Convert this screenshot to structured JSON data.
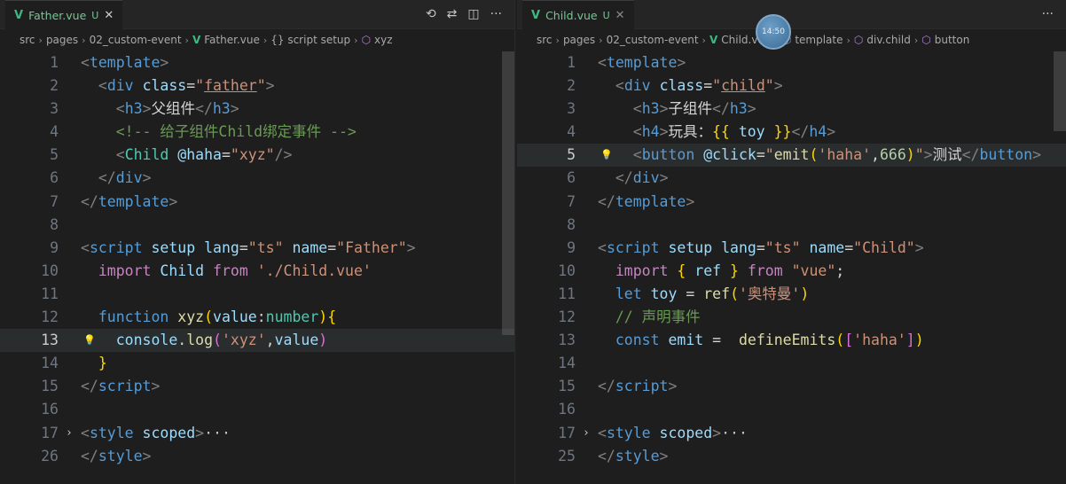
{
  "left": {
    "tab": {
      "name": "Father.vue",
      "status": "U",
      "close": "✕"
    },
    "toolbar": {
      "icons": [
        "history-icon",
        "compare-icon",
        "split-editor-icon",
        "more-icon"
      ],
      "glyphs": [
        "⟲",
        "⇄",
        "◫",
        "···"
      ]
    },
    "breadcrumb": [
      "src",
      "pages",
      "02_custom-event",
      "Father.vue",
      "{} script setup",
      "xyz"
    ],
    "lines": [
      {
        "n": "1",
        "tokens": [
          [
            "t-punc",
            "<"
          ],
          [
            "t-tag",
            "template"
          ],
          [
            "t-punc",
            ">"
          ]
        ]
      },
      {
        "n": "2",
        "tokens": [
          [
            "t-text",
            "  "
          ],
          [
            "t-punc",
            "<"
          ],
          [
            "t-tag",
            "div"
          ],
          [
            "t-text",
            " "
          ],
          [
            "t-attr",
            "class"
          ],
          [
            "t-text",
            "="
          ],
          [
            "t-str",
            "\""
          ],
          [
            "t-str-u",
            "father"
          ],
          [
            "t-str",
            "\""
          ],
          [
            "t-punc",
            ">"
          ]
        ]
      },
      {
        "n": "3",
        "tokens": [
          [
            "t-text",
            "    "
          ],
          [
            "t-punc",
            "<"
          ],
          [
            "t-tag",
            "h3"
          ],
          [
            "t-punc",
            ">"
          ],
          [
            "t-text",
            "父组件"
          ],
          [
            "t-punc",
            "</"
          ],
          [
            "t-tag",
            "h3"
          ],
          [
            "t-punc",
            ">"
          ]
        ]
      },
      {
        "n": "4",
        "tokens": [
          [
            "t-text",
            "    "
          ],
          [
            "t-comment",
            "<!-- 给子组件Child绑定事件 -->"
          ]
        ]
      },
      {
        "n": "5",
        "tokens": [
          [
            "t-text",
            "    "
          ],
          [
            "t-punc",
            "<"
          ],
          [
            "t-type",
            "Child"
          ],
          [
            "t-text",
            " "
          ],
          [
            "t-attr",
            "@haha"
          ],
          [
            "t-text",
            "="
          ],
          [
            "t-str",
            "\"xyz\""
          ],
          [
            "t-punc",
            "/>"
          ]
        ]
      },
      {
        "n": "6",
        "tokens": [
          [
            "t-text",
            "  "
          ],
          [
            "t-punc",
            "</"
          ],
          [
            "t-tag",
            "div"
          ],
          [
            "t-punc",
            ">"
          ]
        ]
      },
      {
        "n": "7",
        "tokens": [
          [
            "t-punc",
            "</"
          ],
          [
            "t-tag",
            "template"
          ],
          [
            "t-punc",
            ">"
          ]
        ]
      },
      {
        "n": "8",
        "tokens": []
      },
      {
        "n": "9",
        "tokens": [
          [
            "t-punc",
            "<"
          ],
          [
            "t-tag",
            "script"
          ],
          [
            "t-text",
            " "
          ],
          [
            "t-attr",
            "setup"
          ],
          [
            "t-text",
            " "
          ],
          [
            "t-attr",
            "lang"
          ],
          [
            "t-text",
            "="
          ],
          [
            "t-str",
            "\"ts\""
          ],
          [
            "t-text",
            " "
          ],
          [
            "t-attr",
            "name"
          ],
          [
            "t-text",
            "="
          ],
          [
            "t-str",
            "\"Father\""
          ],
          [
            "t-punc",
            ">"
          ]
        ]
      },
      {
        "n": "10",
        "tokens": [
          [
            "t-text",
            "  "
          ],
          [
            "t-kw",
            "import"
          ],
          [
            "t-text",
            " "
          ],
          [
            "t-var",
            "Child"
          ],
          [
            "t-text",
            " "
          ],
          [
            "t-kw",
            "from"
          ],
          [
            "t-text",
            " "
          ],
          [
            "t-str",
            "'./Child.vue'"
          ]
        ]
      },
      {
        "n": "11",
        "tokens": []
      },
      {
        "n": "12",
        "tokens": [
          [
            "t-text",
            "  "
          ],
          [
            "t-keyword",
            "function"
          ],
          [
            "t-text",
            " "
          ],
          [
            "t-fn",
            "xyz"
          ],
          [
            "t-br",
            "("
          ],
          [
            "t-var",
            "value"
          ],
          [
            "t-text",
            ":"
          ],
          [
            "t-type",
            "number"
          ],
          [
            "t-br",
            ")"
          ],
          [
            "t-br",
            "{"
          ]
        ]
      },
      {
        "n": "13",
        "tokens": [
          [
            "t-text",
            "    "
          ],
          [
            "t-var",
            "console"
          ],
          [
            "t-text",
            "."
          ],
          [
            "t-fn",
            "log"
          ],
          [
            "t-br2",
            "("
          ],
          [
            "t-str",
            "'xyz'"
          ],
          [
            "t-text",
            ","
          ],
          [
            "t-var",
            "value"
          ],
          [
            "t-br2",
            ")"
          ]
        ]
      },
      {
        "n": "14",
        "tokens": [
          [
            "t-text",
            "  "
          ],
          [
            "t-br",
            "}"
          ]
        ]
      },
      {
        "n": "15",
        "tokens": [
          [
            "t-punc",
            "</"
          ],
          [
            "t-tag",
            "script"
          ],
          [
            "t-punc",
            ">"
          ]
        ]
      },
      {
        "n": "16",
        "tokens": []
      },
      {
        "n": "17",
        "tokens": [
          [
            "t-punc",
            "<"
          ],
          [
            "t-tag",
            "style"
          ],
          [
            "t-text",
            " "
          ],
          [
            "t-attr",
            "scoped"
          ],
          [
            "t-punc",
            ">"
          ],
          [
            "t-dots",
            "···"
          ]
        ]
      },
      {
        "n": "26",
        "tokens": [
          [
            "t-punc",
            "</"
          ],
          [
            "t-tag",
            "style"
          ],
          [
            "t-punc",
            ">"
          ]
        ]
      }
    ]
  },
  "right": {
    "tab": {
      "name": "Child.vue",
      "status": "U",
      "close": "✕"
    },
    "toolbar": {
      "icons": [
        "more-icon"
      ],
      "glyphs": [
        "···"
      ]
    },
    "breadcrumb": [
      "src",
      "pages",
      "02_custom-event",
      "Child.vue",
      "template",
      "div.child",
      "button"
    ],
    "avatar_text": "14:50",
    "lines": [
      {
        "n": "1",
        "tokens": [
          [
            "t-punc",
            "<"
          ],
          [
            "t-tag",
            "template"
          ],
          [
            "t-punc",
            ">"
          ]
        ]
      },
      {
        "n": "2",
        "tokens": [
          [
            "t-text",
            "  "
          ],
          [
            "t-punc",
            "<"
          ],
          [
            "t-tag",
            "div"
          ],
          [
            "t-text",
            " "
          ],
          [
            "t-attr",
            "class"
          ],
          [
            "t-text",
            "="
          ],
          [
            "t-str",
            "\""
          ],
          [
            "t-str-u",
            "child"
          ],
          [
            "t-str",
            "\""
          ],
          [
            "t-punc",
            ">"
          ]
        ]
      },
      {
        "n": "3",
        "tokens": [
          [
            "t-text",
            "    "
          ],
          [
            "t-punc",
            "<"
          ],
          [
            "t-tag",
            "h3"
          ],
          [
            "t-punc",
            ">"
          ],
          [
            "t-text",
            "子组件"
          ],
          [
            "t-punc",
            "</"
          ],
          [
            "t-tag",
            "h3"
          ],
          [
            "t-punc",
            ">"
          ]
        ]
      },
      {
        "n": "4",
        "tokens": [
          [
            "t-text",
            "    "
          ],
          [
            "t-punc",
            "<"
          ],
          [
            "t-tag",
            "h4"
          ],
          [
            "t-punc",
            ">"
          ],
          [
            "t-text",
            "玩具："
          ],
          [
            "t-br",
            "{{"
          ],
          [
            "t-text",
            " "
          ],
          [
            "t-var",
            "toy"
          ],
          [
            "t-text",
            " "
          ],
          [
            "t-br",
            "}}"
          ],
          [
            "t-punc",
            "</"
          ],
          [
            "t-tag",
            "h4"
          ],
          [
            "t-punc",
            ">"
          ]
        ]
      },
      {
        "n": "5",
        "tokens": [
          [
            "t-text",
            "    "
          ],
          [
            "t-punc",
            "<"
          ],
          [
            "t-tag",
            "button"
          ],
          [
            "t-text",
            " "
          ],
          [
            "t-attr",
            "@click"
          ],
          [
            "t-text",
            "="
          ],
          [
            "t-str",
            "\""
          ],
          [
            "t-fn",
            "emit"
          ],
          [
            "t-br",
            "("
          ],
          [
            "t-str",
            "'haha'"
          ],
          [
            "t-text",
            ","
          ],
          [
            "t-num",
            "666"
          ],
          [
            "t-br",
            ")"
          ],
          [
            "t-str",
            "\""
          ],
          [
            "t-punc",
            ">"
          ],
          [
            "t-text",
            "测试"
          ],
          [
            "t-punc",
            "</"
          ],
          [
            "t-tag",
            "button"
          ],
          [
            "t-punc",
            ">"
          ]
        ]
      },
      {
        "n": "6",
        "tokens": [
          [
            "t-text",
            "  "
          ],
          [
            "t-punc",
            "</"
          ],
          [
            "t-tag",
            "div"
          ],
          [
            "t-punc",
            ">"
          ]
        ]
      },
      {
        "n": "7",
        "tokens": [
          [
            "t-punc",
            "</"
          ],
          [
            "t-tag",
            "template"
          ],
          [
            "t-punc",
            ">"
          ]
        ]
      },
      {
        "n": "8",
        "tokens": []
      },
      {
        "n": "9",
        "tokens": [
          [
            "t-punc",
            "<"
          ],
          [
            "t-tag",
            "script"
          ],
          [
            "t-text",
            " "
          ],
          [
            "t-attr",
            "setup"
          ],
          [
            "t-text",
            " "
          ],
          [
            "t-attr",
            "lang"
          ],
          [
            "t-text",
            "="
          ],
          [
            "t-str",
            "\"ts\""
          ],
          [
            "t-text",
            " "
          ],
          [
            "t-attr",
            "name"
          ],
          [
            "t-text",
            "="
          ],
          [
            "t-str",
            "\"Child\""
          ],
          [
            "t-punc",
            ">"
          ]
        ]
      },
      {
        "n": "10",
        "tokens": [
          [
            "t-text",
            "  "
          ],
          [
            "t-kw",
            "import"
          ],
          [
            "t-text",
            " "
          ],
          [
            "t-br",
            "{"
          ],
          [
            "t-text",
            " "
          ],
          [
            "t-var",
            "ref"
          ],
          [
            "t-text",
            " "
          ],
          [
            "t-br",
            "}"
          ],
          [
            "t-text",
            " "
          ],
          [
            "t-kw",
            "from"
          ],
          [
            "t-text",
            " "
          ],
          [
            "t-str",
            "\"vue\""
          ],
          [
            "t-text",
            ";"
          ]
        ]
      },
      {
        "n": "11",
        "tokens": [
          [
            "t-text",
            "  "
          ],
          [
            "t-keyword",
            "let"
          ],
          [
            "t-text",
            " "
          ],
          [
            "t-var",
            "toy"
          ],
          [
            "t-text",
            " = "
          ],
          [
            "t-fn",
            "ref"
          ],
          [
            "t-br",
            "("
          ],
          [
            "t-str",
            "'奥特曼'"
          ],
          [
            "t-br",
            ")"
          ]
        ]
      },
      {
        "n": "12",
        "tokens": [
          [
            "t-text",
            "  "
          ],
          [
            "t-comment",
            "// 声明事件"
          ]
        ]
      },
      {
        "n": "13",
        "tokens": [
          [
            "t-text",
            "  "
          ],
          [
            "t-keyword",
            "const"
          ],
          [
            "t-text",
            " "
          ],
          [
            "t-var",
            "emit"
          ],
          [
            "t-text",
            " =  "
          ],
          [
            "t-fn",
            "defineEmits"
          ],
          [
            "t-br",
            "("
          ],
          [
            "t-br2",
            "["
          ],
          [
            "t-str",
            "'haha'"
          ],
          [
            "t-br2",
            "]"
          ],
          [
            "t-br",
            ")"
          ]
        ]
      },
      {
        "n": "14",
        "tokens": []
      },
      {
        "n": "15",
        "tokens": [
          [
            "t-punc",
            "</"
          ],
          [
            "t-tag",
            "script"
          ],
          [
            "t-punc",
            ">"
          ]
        ]
      },
      {
        "n": "16",
        "tokens": []
      },
      {
        "n": "17",
        "tokens": [
          [
            "t-punc",
            "<"
          ],
          [
            "t-tag",
            "style"
          ],
          [
            "t-text",
            " "
          ],
          [
            "t-attr",
            "scoped"
          ],
          [
            "t-punc",
            ">"
          ],
          [
            "t-dots",
            "···"
          ]
        ]
      },
      {
        "n": "25",
        "tokens": [
          [
            "t-punc",
            "</"
          ],
          [
            "t-tag",
            "style"
          ],
          [
            "t-punc",
            ">"
          ]
        ]
      }
    ]
  }
}
